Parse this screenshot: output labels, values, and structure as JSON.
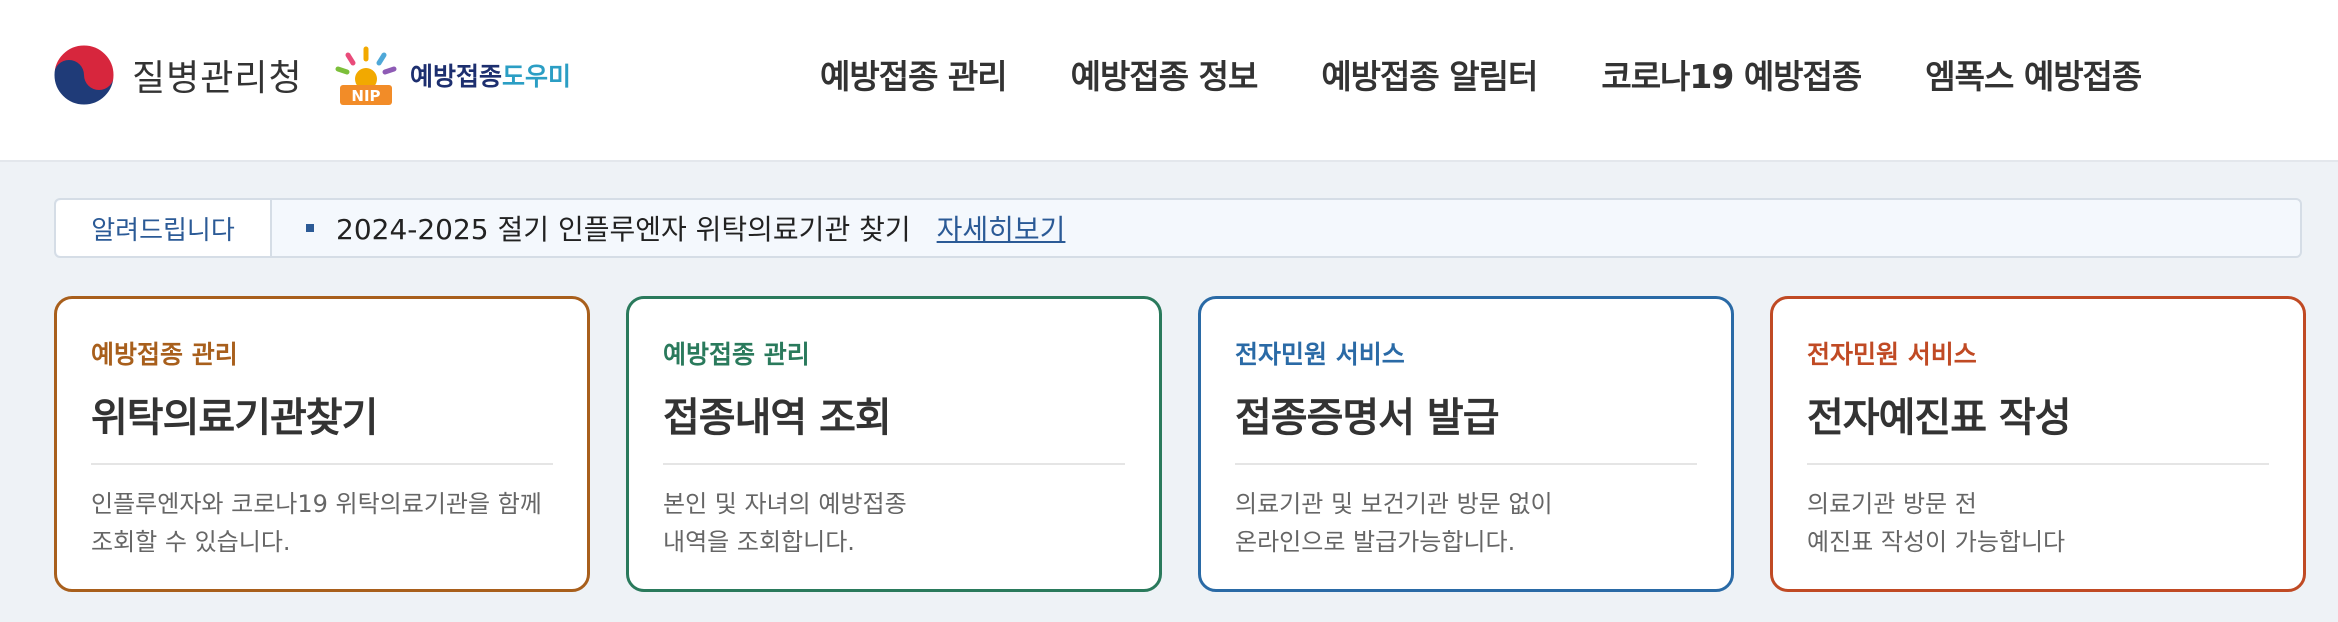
{
  "header": {
    "logo_text": "질병관리청",
    "nip_text_1": "예방접종",
    "nip_text_2": "도우미",
    "nip_badge": "NIP",
    "nav": [
      "예방접종 관리",
      "예방접종 정보",
      "예방접종 알림터",
      "코로나19 예방접종",
      "엠폭스 예방접종"
    ]
  },
  "notice": {
    "label": "알려드립니다",
    "text": "2024-2025 절기 인플루엔자 위탁의료기관 찾기",
    "link": "자세히보기"
  },
  "cards": [
    {
      "category": "예방접종 관리",
      "title": "위탁의료기관찾기",
      "desc1": "인플루엔자와 코로나19 위탁의료기관을 함께",
      "desc2": "조회할 수 있습니다.",
      "color": "#a85f1c"
    },
    {
      "category": "예방접종 관리",
      "title": "접종내역 조회",
      "desc1": "본인 및 자녀의 예방접종",
      "desc2": "내역을 조회합니다.",
      "color": "#2a7a5c"
    },
    {
      "category": "전자민원 서비스",
      "title": "접종증명서 발급",
      "desc1": "의료기관 및 보건기관 방문 없이",
      "desc2": "온라인으로 발급가능합니다.",
      "color": "#2a6aa6"
    },
    {
      "category": "전자민원 서비스",
      "title": "전자예진표 작성",
      "desc1": "의료기관 방문 전",
      "desc2": "예진표 작성이 가능합니다",
      "color": "#c04a24"
    }
  ]
}
